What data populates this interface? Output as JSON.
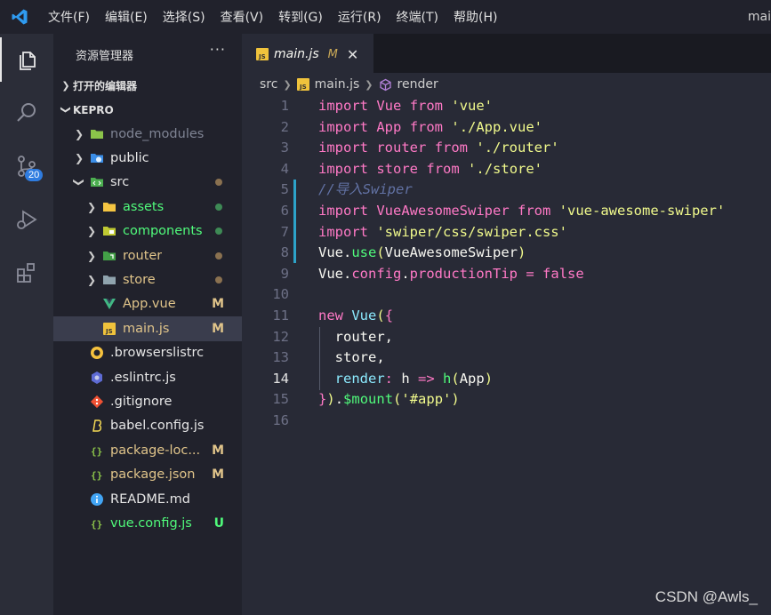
{
  "menubar": {
    "items": [
      "文件(F)",
      "编辑(E)",
      "选择(S)",
      "查看(V)",
      "转到(G)",
      "运行(R)",
      "终端(T)",
      "帮助(H)"
    ],
    "window_title": "mai"
  },
  "activitybar": {
    "icons": [
      "explorer-icon",
      "search-icon",
      "source-control-icon",
      "run-debug-icon",
      "extensions-icon"
    ],
    "source_control_badge": "20"
  },
  "sidebar": {
    "title": "资源管理器",
    "more": "···",
    "open_editors_label": "打开的编辑器",
    "project_label": "KEPRO",
    "tree": [
      {
        "label": "node_modules",
        "type": "folder",
        "icon": "node-folder-icon",
        "color": "#7f8494",
        "decoration": ""
      },
      {
        "label": "public",
        "type": "folder",
        "icon": "public-folder-icon",
        "color": "#e6e6e6",
        "decoration": ""
      },
      {
        "label": "src",
        "type": "folder",
        "icon": "src-folder-icon",
        "color": "#e6e6e6",
        "decoration": "dot-brown"
      },
      {
        "label": "assets",
        "type": "folder",
        "icon": "assets-folder-icon",
        "color": "#50fa7b",
        "decoration": "dot-green"
      },
      {
        "label": "components",
        "type": "folder",
        "icon": "components-folder-icon",
        "color": "#50fa7b",
        "decoration": "dot-green"
      },
      {
        "label": "router",
        "type": "folder",
        "icon": "router-folder-icon",
        "color": "#e0c48a",
        "decoration": "dot-brown"
      },
      {
        "label": "store",
        "type": "folder",
        "icon": "store-folder-icon",
        "color": "#e0c48a",
        "decoration": "dot-brown"
      },
      {
        "label": "App.vue",
        "type": "file",
        "icon": "vue-file-icon",
        "color": "#e0c48a",
        "decoration": "M"
      },
      {
        "label": "main.js",
        "type": "file",
        "icon": "js-file-icon",
        "color": "#e0c48a",
        "decoration": "M"
      },
      {
        "label": ".browserslistrc",
        "type": "file",
        "icon": "browserslist-file-icon",
        "color": "#e6e6e6",
        "decoration": ""
      },
      {
        "label": ".eslintrc.js",
        "type": "file",
        "icon": "eslint-file-icon",
        "color": "#e6e6e6",
        "decoration": ""
      },
      {
        "label": ".gitignore",
        "type": "file",
        "icon": "git-file-icon",
        "color": "#e6e6e6",
        "decoration": ""
      },
      {
        "label": "babel.config.js",
        "type": "file",
        "icon": "babel-file-icon",
        "color": "#e6e6e6",
        "decoration": ""
      },
      {
        "label": "package-loc...",
        "type": "file",
        "icon": "json-file-icon",
        "color": "#e0c48a",
        "decoration": "M"
      },
      {
        "label": "package.json",
        "type": "file",
        "icon": "json-file-icon",
        "color": "#e0c48a",
        "decoration": "M"
      },
      {
        "label": "README.md",
        "type": "file",
        "icon": "info-file-icon",
        "color": "#e6e6e6",
        "decoration": ""
      },
      {
        "label": "vue.config.js",
        "type": "file",
        "icon": "js-config-file-icon",
        "color": "#50fa7b",
        "decoration": "U"
      }
    ]
  },
  "tab": {
    "label": "main.js",
    "decoration": "M",
    "close": "✕"
  },
  "breadcrumb": {
    "folder": "src",
    "file": "main.js",
    "symbol": "render"
  },
  "code": {
    "current_line": "14",
    "lines": [
      {
        "n": "1",
        "tokens": [
          [
            "kw",
            "import"
          ],
          [
            "pl",
            " "
          ],
          [
            "kw",
            "Vue"
          ],
          [
            "pl",
            " "
          ],
          [
            "kw",
            "from"
          ],
          [
            "pl",
            " "
          ],
          [
            "str",
            "'vue'"
          ]
        ]
      },
      {
        "n": "2",
        "tokens": [
          [
            "kw",
            "import"
          ],
          [
            "pl",
            " "
          ],
          [
            "kw",
            "App"
          ],
          [
            "pl",
            " "
          ],
          [
            "kw",
            "from"
          ],
          [
            "pl",
            " "
          ],
          [
            "str",
            "'./App.vue'"
          ]
        ]
      },
      {
        "n": "3",
        "tokens": [
          [
            "kw",
            "import"
          ],
          [
            "pl",
            " "
          ],
          [
            "kw",
            "router"
          ],
          [
            "pl",
            " "
          ],
          [
            "kw",
            "from"
          ],
          [
            "pl",
            " "
          ],
          [
            "str",
            "'./router'"
          ]
        ]
      },
      {
        "n": "4",
        "tokens": [
          [
            "kw",
            "import"
          ],
          [
            "pl",
            " "
          ],
          [
            "kw",
            "store"
          ],
          [
            "pl",
            " "
          ],
          [
            "kw",
            "from"
          ],
          [
            "pl",
            " "
          ],
          [
            "str",
            "'./store'"
          ]
        ]
      },
      {
        "n": "5",
        "tokens": [
          [
            "cm",
            "//导入Swiper"
          ]
        ]
      },
      {
        "n": "6",
        "tokens": [
          [
            "kw",
            "import"
          ],
          [
            "pl",
            " "
          ],
          [
            "kw",
            "VueAwesomeSwiper"
          ],
          [
            "pl",
            " "
          ],
          [
            "kw",
            "from"
          ],
          [
            "pl",
            " "
          ],
          [
            "str",
            "'vue-awesome-swiper'"
          ]
        ]
      },
      {
        "n": "7",
        "tokens": [
          [
            "kw",
            "import"
          ],
          [
            "pl",
            " "
          ],
          [
            "str",
            "'swiper/css/swiper.css'"
          ]
        ]
      },
      {
        "n": "8",
        "tokens": [
          [
            "pl",
            "Vue."
          ],
          [
            "fn",
            "use"
          ],
          [
            "br",
            "("
          ],
          [
            "pl",
            "VueAwesomeSwiper"
          ],
          [
            "br",
            ")"
          ]
        ]
      },
      {
        "n": "9",
        "tokens": [
          [
            "pl",
            "Vue."
          ],
          [
            "prop",
            "config"
          ],
          [
            "pl",
            "."
          ],
          [
            "prop",
            "productionTip"
          ],
          [
            "pl",
            " "
          ],
          [
            "kw",
            "="
          ],
          [
            "pl",
            " "
          ],
          [
            "kw",
            "false"
          ]
        ]
      },
      {
        "n": "10",
        "tokens": []
      },
      {
        "n": "11",
        "tokens": [
          [
            "kw",
            "new"
          ],
          [
            "pl",
            " "
          ],
          [
            "cls",
            "Vue"
          ],
          [
            "br",
            "("
          ],
          [
            "kw",
            "{"
          ]
        ]
      },
      {
        "n": "12",
        "tokens": [
          [
            "pl",
            "  router,"
          ]
        ]
      },
      {
        "n": "13",
        "tokens": [
          [
            "pl",
            "  store,"
          ]
        ]
      },
      {
        "n": "14",
        "tokens": [
          [
            "pl",
            "  "
          ],
          [
            "cls",
            "render"
          ],
          [
            "kw",
            ":"
          ],
          [
            "pl",
            " h "
          ],
          [
            "kw",
            "=>"
          ],
          [
            "pl",
            " "
          ],
          [
            "fn",
            "h"
          ],
          [
            "br",
            "("
          ],
          [
            "pl",
            "App"
          ],
          [
            "br",
            ")"
          ]
        ]
      },
      {
        "n": "15",
        "tokens": [
          [
            "kw",
            "}"
          ],
          [
            "br",
            ")"
          ],
          [
            "pl",
            "."
          ],
          [
            "fn",
            "$mount"
          ],
          [
            "br",
            "("
          ],
          [
            "str",
            "'#app'"
          ],
          [
            "br",
            ")"
          ]
        ]
      },
      {
        "n": "16",
        "tokens": []
      }
    ]
  },
  "watermark": "CSDN @Awls_",
  "colors": {
    "accent": "#2f7ce0",
    "modified": "#e0c48a",
    "untracked": "#50fa7b",
    "git_added_bar": "#2da3c9"
  }
}
